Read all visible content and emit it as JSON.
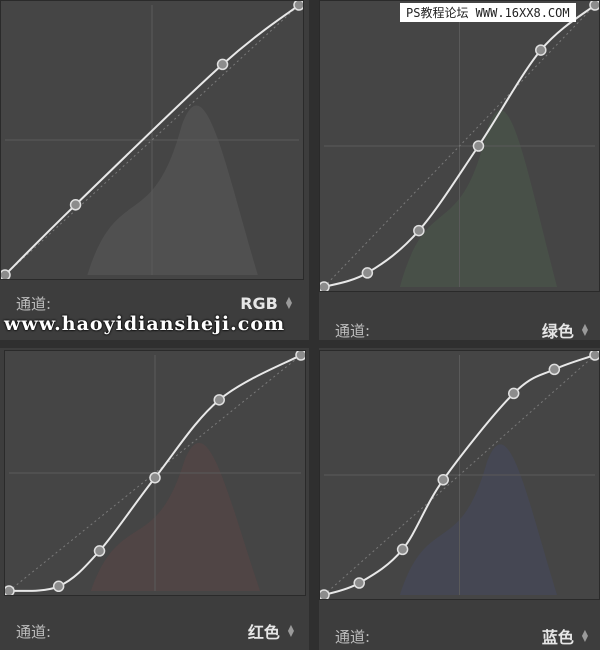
{
  "watermark_top": "PS教程论坛 WWW.16XX8.COM",
  "watermark_mid": "www.haoyidiansheji.com",
  "panels": [
    {
      "channel_label": "通道:",
      "channel_value": "RGB",
      "curve_points": [
        [
          0,
          0
        ],
        [
          0.24,
          0.26
        ],
        [
          0.74,
          0.78
        ],
        [
          1,
          1
        ]
      ],
      "histogram_color": "#5a5a5a"
    },
    {
      "channel_label": "通道:",
      "channel_value": "绿色",
      "curve_points": [
        [
          0,
          0
        ],
        [
          0.16,
          0.05
        ],
        [
          0.35,
          0.2
        ],
        [
          0.57,
          0.5
        ],
        [
          0.8,
          0.84
        ],
        [
          1,
          1
        ]
      ],
      "histogram_color": "#4a5a4a"
    },
    {
      "channel_label": "通道:",
      "channel_value": "红色",
      "curve_points": [
        [
          0,
          0
        ],
        [
          0.17,
          0.02
        ],
        [
          0.31,
          0.17
        ],
        [
          0.5,
          0.48
        ],
        [
          0.72,
          0.81
        ],
        [
          1,
          1
        ]
      ],
      "histogram_color": "#5a4646"
    },
    {
      "channel_label": "通道:",
      "channel_value": "蓝色",
      "curve_points": [
        [
          0,
          0
        ],
        [
          0.13,
          0.05
        ],
        [
          0.29,
          0.19
        ],
        [
          0.44,
          0.48
        ],
        [
          0.7,
          0.84
        ],
        [
          0.85,
          0.94
        ],
        [
          1,
          1
        ]
      ],
      "histogram_color": "#45495e"
    }
  ]
}
